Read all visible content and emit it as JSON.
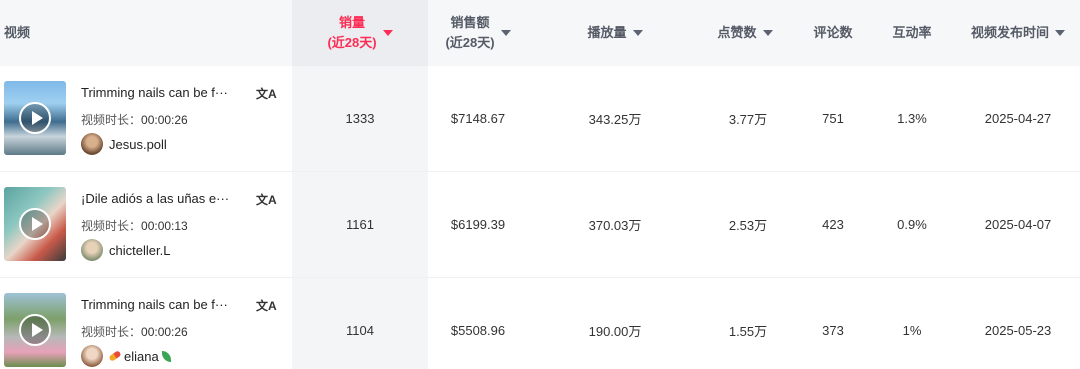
{
  "header": {
    "video": "视频",
    "sales": "销量",
    "sales_sub": "(近28天)",
    "revenue": "销售额",
    "revenue_sub": "(近28天)",
    "views": "播放量",
    "likes": "点赞数",
    "comments": "评论数",
    "engagement": "互动率",
    "publish_time": "视频发布时间"
  },
  "duration_label": "视频时长：",
  "translate_glyph": "文A",
  "colors": {
    "accent": "#fe2c55",
    "header_bg": "#f6f7f9",
    "sorted_bg": "#ebedf0"
  },
  "rows": [
    {
      "title": "Trimming nails can be f···",
      "duration": "00:00:26",
      "author": "Jesus.poll",
      "sales": "1333",
      "revenue": "$7148.67",
      "views": "343.25万",
      "likes": "3.77万",
      "comments": "751",
      "engagement": "1.3%",
      "publish_date": "2025-04-27"
    },
    {
      "title": "¡Dile adiós a las uñas e···",
      "duration": "00:00:13",
      "author": "chicteller.L",
      "sales": "1161",
      "revenue": "$6199.39",
      "views": "370.03万",
      "likes": "2.53万",
      "comments": "423",
      "engagement": "0.9%",
      "publish_date": "2025-04-07"
    },
    {
      "title": "Trimming nails can be f···",
      "duration": "00:00:26",
      "author": "eliana",
      "sales": "1104",
      "revenue": "$5508.96",
      "views": "190.00万",
      "likes": "1.55万",
      "comments": "373",
      "engagement": "1%",
      "publish_date": "2025-05-23"
    }
  ]
}
